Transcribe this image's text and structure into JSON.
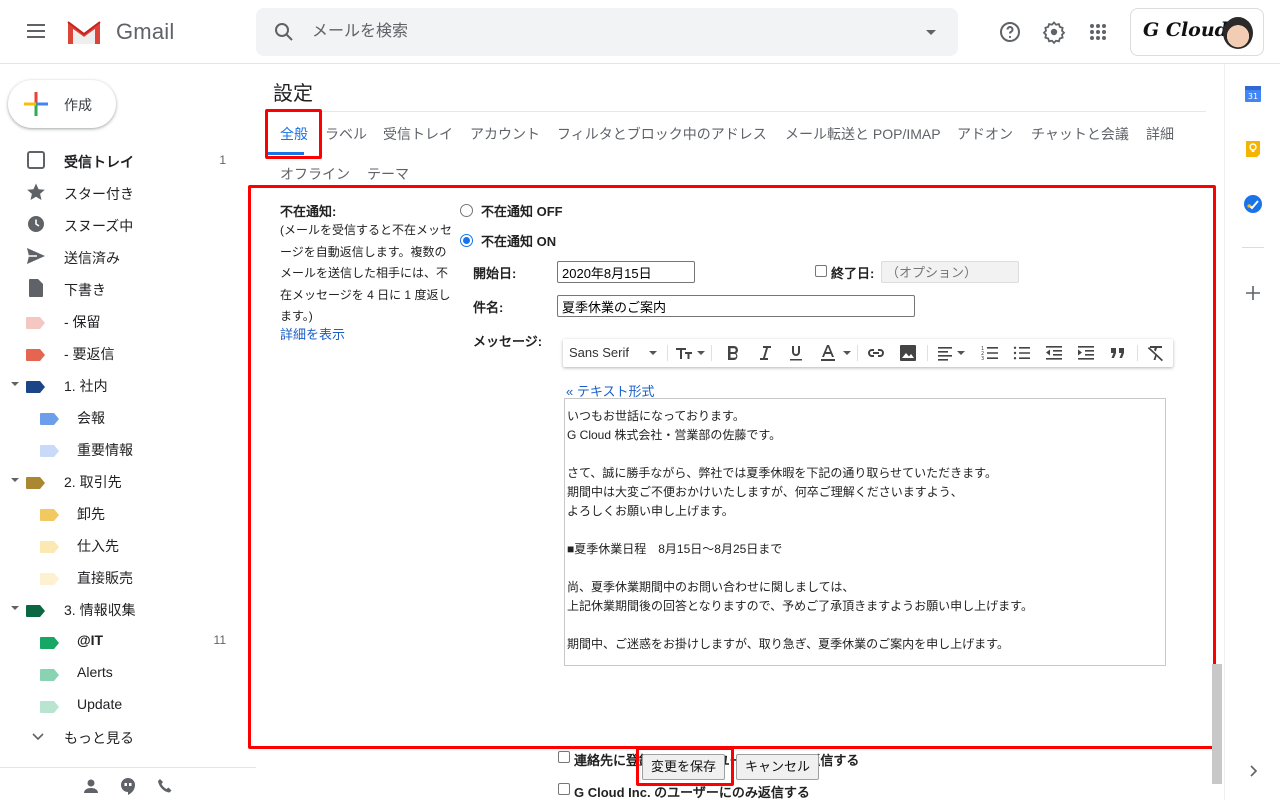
{
  "header": {
    "app_name": "Gmail",
    "search_placeholder": "メールを検索",
    "account_brand": "G Cloud",
    "icons": [
      "menu-icon",
      "gmail-logo",
      "search-icon",
      "search-options-icon",
      "help-icon",
      "settings-icon",
      "apps-icon",
      "avatar"
    ]
  },
  "sidebar": {
    "compose_label": "作成",
    "items": [
      {
        "label": "受信トレイ",
        "count": "1",
        "icon": "inbox-icon",
        "bold": true
      },
      {
        "label": "スター付き",
        "icon": "star-icon"
      },
      {
        "label": "スヌーズ中",
        "icon": "clock-icon"
      },
      {
        "label": "送信済み",
        "icon": "send-icon"
      },
      {
        "label": "下書き",
        "icon": "draft-icon"
      },
      {
        "label": "- 保留",
        "icon": "label-icon",
        "color": "#f4c7c3"
      },
      {
        "label": "- 要返信",
        "icon": "label-icon",
        "color": "#e66550"
      },
      {
        "label": "1. 社内",
        "icon": "label-icon",
        "color": "#1c4587",
        "expanded": true
      },
      {
        "label": "会報",
        "icon": "label-icon",
        "color": "#6d9eeb",
        "sub": true
      },
      {
        "label": "重要情報",
        "icon": "label-icon",
        "color": "#c9daf8",
        "sub": true
      },
      {
        "label": "2. 取引先",
        "icon": "label-icon",
        "color": "#aa8831",
        "expanded": true
      },
      {
        "label": "卸先",
        "icon": "label-icon",
        "color": "#f2c960",
        "sub": true
      },
      {
        "label": "仕入先",
        "icon": "label-icon",
        "color": "#fce8b3",
        "sub": true
      },
      {
        "label": "直接販売",
        "icon": "label-icon",
        "color": "#fef1d1",
        "sub": true
      },
      {
        "label": "3. 情報収集",
        "icon": "label-icon",
        "color": "#0b6741",
        "expanded": true
      },
      {
        "label": "@IT",
        "count": "11",
        "icon": "label-icon",
        "color": "#16a765",
        "sub": true,
        "bold": true
      },
      {
        "label": "Alerts",
        "icon": "label-icon",
        "color": "#89d3b2",
        "sub": true
      },
      {
        "label": "Update",
        "icon": "label-icon",
        "color": "#b9e4d0",
        "sub": true
      }
    ],
    "more_label": "もっと見る",
    "footer_icons": [
      "contacts-icon",
      "hangouts-icon",
      "phone-icon"
    ]
  },
  "settings": {
    "title": "設定",
    "tabs": [
      {
        "label": "全般",
        "active": true
      },
      {
        "label": "ラベル"
      },
      {
        "label": "受信トレイ"
      },
      {
        "label": "アカウント"
      },
      {
        "label": "フィルタとブロック中のアドレス"
      },
      {
        "label": "メール転送と POP/IMAP"
      },
      {
        "label": "アドオン"
      },
      {
        "label": "チャットと会議"
      },
      {
        "label": "詳細"
      },
      {
        "label": "オフライン"
      },
      {
        "label": "テーマ"
      }
    ],
    "vacation": {
      "title": "不在通知:",
      "description": "(メールを受信すると不在メッセージを自動返信します。複数のメールを送信した相手には、不在メッセージを 4 日に 1 度返します。)",
      "details_link": "詳細を表示",
      "option_off": "不在通知 OFF",
      "option_on": "不在通知 ON",
      "selected": "on",
      "start_label": "開始日:",
      "start_value": "2020年8月15日",
      "end_label": "終了日:",
      "end_checked": false,
      "end_placeholder": "（オプション）",
      "subject_label": "件名:",
      "subject_value": "夏季休業のご案内",
      "message_label": "メッセージ:",
      "font_name": "Sans Serif",
      "toolbar_icons": [
        "font-size-icon",
        "bold-icon",
        "italic-icon",
        "underline-icon",
        "text-color-icon",
        "link-icon",
        "image-icon",
        "align-icon",
        "numbered-list-icon",
        "bulleted-list-icon",
        "indent-less-icon",
        "indent-more-icon",
        "quote-icon",
        "remove-formatting-icon"
      ],
      "plain_text_link": "« テキスト形式",
      "message_body": "いつもお世話になっております。\nG Cloud 株式会社・営業部の佐藤です。\n\nさて、誠に勝手ながら、弊社では夏季休暇を下記の通り取らせていただきます。\n期間中は大変ご不便おかけいたしますが、何卒ご理解くださいますよう、\nよろしくお願い申し上げます。\n\n■夏季休業日程　8月15日〜8月25日まで\n\n尚、夏季休業期間中のお問い合わせに関しましては、\n上記休業期間後の回答となりますので、予めご了承頂きますようお願い申し上げます。\n\n期間中、ご迷惑をお掛けしますが、取り急ぎ、夏季休業のご案内を申し上げます。",
      "contacts_only_label": "連絡先に登録されているユーザーにのみ返信する",
      "contacts_only_checked": false,
      "domain_only_label": "G Cloud Inc. のユーザーにのみ返信する",
      "domain_only_checked": false
    },
    "save_label": "変更を保存",
    "cancel_label": "キャンセル"
  },
  "right_rail": {
    "icons": [
      "calendar-icon",
      "keep-icon",
      "tasks-icon",
      "add-addon-icon",
      "expand-icon"
    ],
    "calendar_day": "31"
  },
  "highlight_color": "#ff0000",
  "accent_color": "#1a73e8"
}
